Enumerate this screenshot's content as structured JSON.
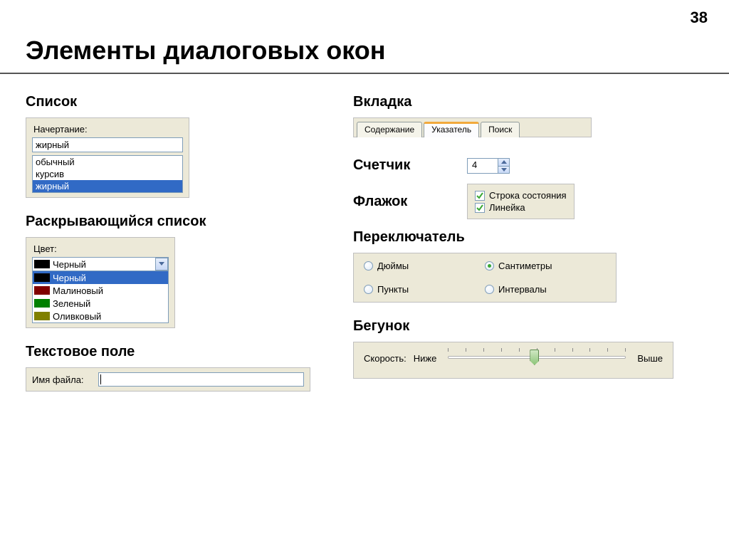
{
  "page_number": "38",
  "title": "Элементы диалоговых окон",
  "left": {
    "listbox_section": "Список",
    "listbox": {
      "label": "Начертание:",
      "value": "жирный",
      "options": [
        "обычный",
        "курсив",
        "жирный"
      ],
      "selected_index": 2
    },
    "dropdown_section": "Раскрывающийся список",
    "dropdown": {
      "label": "Цвет:",
      "value": "Черный",
      "options": [
        {
          "name": "Черный",
          "swatch": "black",
          "selected": true
        },
        {
          "name": "Малиновый",
          "swatch": "crimson",
          "selected": false
        },
        {
          "name": "Зеленый",
          "swatch": "green",
          "selected": false
        },
        {
          "name": "Оливковый",
          "swatch": "olive",
          "selected": false
        }
      ]
    },
    "textfield_section": "Текстовое поле",
    "textfield": {
      "label": "Имя файла:",
      "value": ""
    }
  },
  "right": {
    "tab_section": "Вкладка",
    "tabs": {
      "items": [
        "Содержание",
        "Указатель",
        "Поиск"
      ],
      "active_index": 1
    },
    "counter_section": "Счетчик",
    "counter_value": "4",
    "checkbox_section": "Флажок",
    "checkboxes": [
      {
        "label": "Строка состояния",
        "checked": true
      },
      {
        "label": "Линейка",
        "checked": true
      }
    ],
    "radio_section": "Переключатель",
    "radios": [
      {
        "label": "Дюймы",
        "checked": false
      },
      {
        "label": "Сантиметры",
        "checked": true
      },
      {
        "label": "Пункты",
        "checked": false
      },
      {
        "label": "Интервалы",
        "checked": false
      }
    ],
    "slider_section": "Бегунок",
    "slider": {
      "label": "Скорость:",
      "min_label": "Ниже",
      "max_label": "Выше"
    }
  }
}
